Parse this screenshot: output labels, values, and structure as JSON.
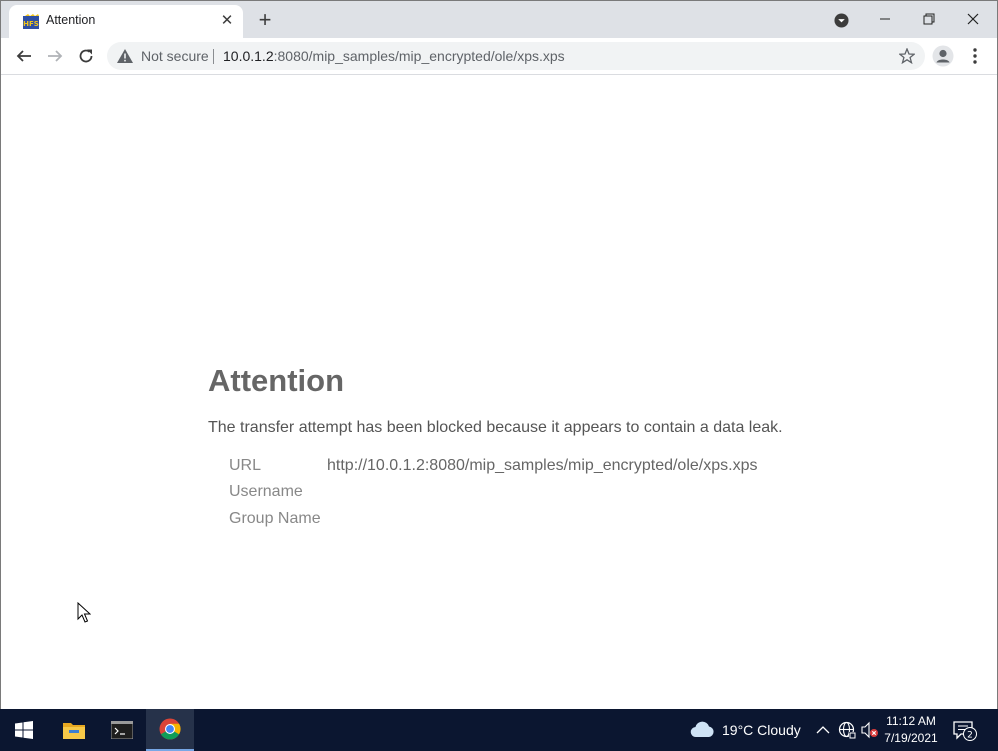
{
  "browser": {
    "tab_title": "Attention",
    "new_tab_label": "+",
    "security_label": "Not secure",
    "url_host": "10.0.1.2",
    "url_rest": ":8080/mip_samples/mip_encrypted/ole/xps.xps"
  },
  "page": {
    "heading": "Attention",
    "message": "The transfer attempt has been blocked because it appears to contain a data leak.",
    "details": [
      {
        "label": "URL",
        "value": "http://10.0.1.2:8080/mip_samples/mip_encrypted/ole/xps.xps"
      },
      {
        "label": "Username",
        "value": ""
      },
      {
        "label": "Group Name",
        "value": ""
      }
    ]
  },
  "taskbar": {
    "weather": "19°C  Cloudy",
    "time": "11:12 AM",
    "date": "7/19/2021",
    "notification_count": "2"
  },
  "colors": {
    "heading": "#666666",
    "taskbar_bg": "#0b1630",
    "tabstrip_bg": "#dee1e6"
  }
}
